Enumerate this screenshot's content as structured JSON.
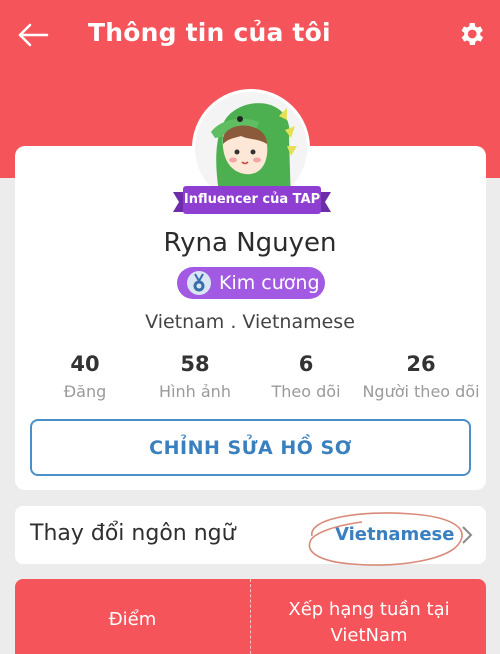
{
  "header": {
    "title": "Thông tin của tôi",
    "accent_color": "#f5545a",
    "back_icon": "arrow-left-icon",
    "settings_icon": "gear-icon"
  },
  "profile": {
    "influencer_badge": "Influencer của TAP",
    "name": "Ryna Nguyen",
    "tier_label": "Kim cương",
    "tier_icon": "medal-icon",
    "location": "Vietnam . Vietnamese",
    "stats": [
      {
        "value": "40",
        "label": "Đăng"
      },
      {
        "value": "58",
        "label": "Hình ảnh"
      },
      {
        "value": "6",
        "label": "Theo dõi"
      },
      {
        "value": "26",
        "label": "Người theo dõi"
      }
    ],
    "edit_button": "CHỈNH SỬA HỒ SƠ"
  },
  "language": {
    "label": "Thay đổi ngôn ngữ",
    "value": "Vietnamese"
  },
  "bottom": {
    "left_label": "Điểm",
    "right_line1": "Xếp hạng tuần tại",
    "right_line2": "VietNam"
  }
}
